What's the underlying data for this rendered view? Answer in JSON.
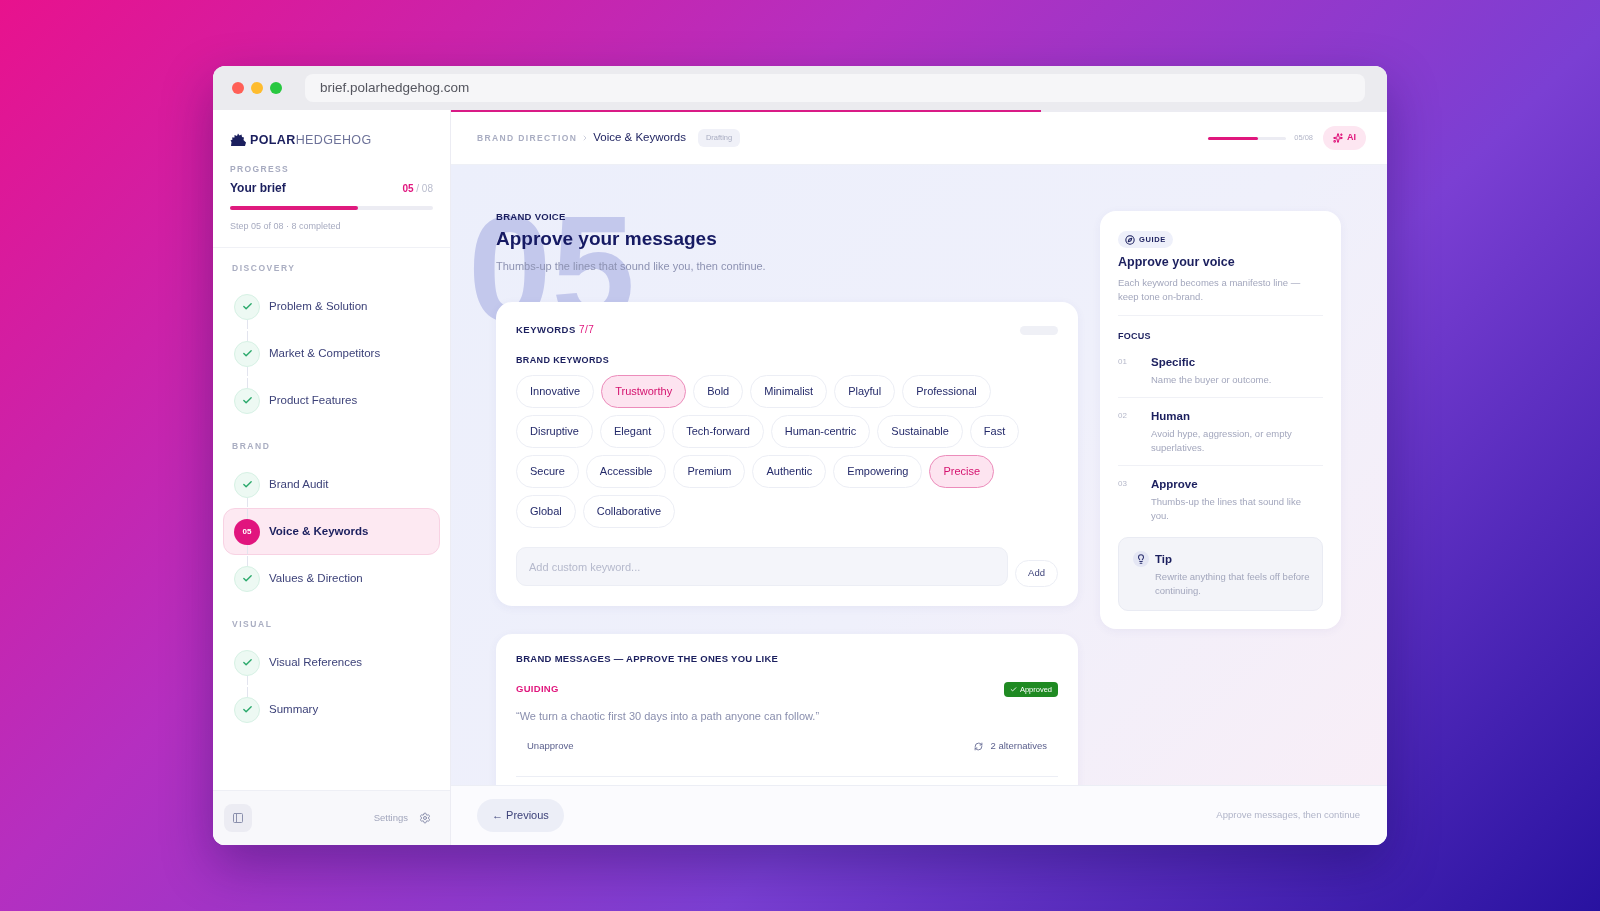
{
  "browser": {
    "url": "brief.polarhedgehog.com"
  },
  "sidebar": {
    "logo": {
      "strong": "POLAR",
      "light": "HEDGEHOG"
    },
    "progress": {
      "label": "PROGRESS",
      "title": "Your brief",
      "current": "05",
      "total": "/ 08",
      "level": 0.63,
      "caption": "Step 05 of 08 · 8 completed"
    },
    "sections": [
      {
        "label": "DISCOVERY",
        "items": [
          {
            "label": "Problem & Solution",
            "kind": "done",
            "selected": false
          },
          {
            "label": "Market & Competitors",
            "kind": "done",
            "selected": false
          },
          {
            "label": "Product Features",
            "kind": "done",
            "selected": false
          }
        ]
      },
      {
        "label": "BRAND",
        "items": [
          {
            "label": "Brand Audit",
            "kind": "done",
            "selected": false
          },
          {
            "label": "Voice & Keywords",
            "kind": "current",
            "step": "05",
            "selected": true
          },
          {
            "label": "Values & Direction",
            "kind": "done",
            "selected": false
          }
        ]
      },
      {
        "label": "VISUAL",
        "items": [
          {
            "label": "Visual References",
            "kind": "done",
            "selected": false
          },
          {
            "label": "Summary",
            "kind": "done",
            "selected": false
          }
        ]
      }
    ],
    "footer": {
      "settings": "Settings"
    }
  },
  "header": {
    "top_progress": {
      "level": 0.63
    },
    "breadcrumb": {
      "parent": "BRAND DIRECTION",
      "current": "Voice & Keywords"
    },
    "status": "Drafting",
    "progress": {
      "level": 0.64,
      "reading": "05/08"
    },
    "ai_button": "AI"
  },
  "intro": {
    "watermark": "05",
    "eyebrow": "BRAND VOICE",
    "title": "Approve your messages",
    "subtitle": "Thumbs-up the lines that sound like you, then continue."
  },
  "keywords_card": {
    "title": "KEYWORDS",
    "count": "7/7",
    "section": "BRAND KEYWORDS",
    "keywords": [
      {
        "label": "Innovative",
        "selected": false
      },
      {
        "label": "Trustworthy",
        "selected": true
      },
      {
        "label": "Bold",
        "selected": false
      },
      {
        "label": "Minimalist",
        "selected": false
      },
      {
        "label": "Playful",
        "selected": false
      },
      {
        "label": "Professional",
        "selected": false
      },
      {
        "label": "Disruptive",
        "selected": false
      },
      {
        "label": "Elegant",
        "selected": false
      },
      {
        "label": "Tech-forward",
        "selected": false
      },
      {
        "label": "Human-centric",
        "selected": false
      },
      {
        "label": "Sustainable",
        "selected": false
      },
      {
        "label": "Fast",
        "selected": false
      },
      {
        "label": "Secure",
        "selected": false
      },
      {
        "label": "Accessible",
        "selected": false
      },
      {
        "label": "Premium",
        "selected": false
      },
      {
        "label": "Authentic",
        "selected": false
      },
      {
        "label": "Empowering",
        "selected": false
      },
      {
        "label": "Precise",
        "selected": true
      },
      {
        "label": "Global",
        "selected": false
      },
      {
        "label": "Collaborative",
        "selected": false
      }
    ],
    "input": {
      "placeholder": "Add custom keyword..."
    },
    "add_button": "Add"
  },
  "messages_card": {
    "title": "BRAND MESSAGES — APPROVE THE ONES YOU LIKE",
    "messages": [
      {
        "category": "GUIDING",
        "approved": true,
        "badge": "Approved",
        "text": "“We turn a chaotic first 30 days into a path anyone can follow.”",
        "action": "Unapprove",
        "alternatives": "2 alternatives"
      }
    ]
  },
  "guide": {
    "tag": "GUIDE",
    "title": "Approve your voice",
    "description": "Each keyword becomes a manifesto line — keep tone on-brand.",
    "focus_label": "FOCUS",
    "focus": [
      {
        "number": "01",
        "title": "Specific",
        "text": "Name the buyer or outcome."
      },
      {
        "number": "02",
        "title": "Human",
        "text": "Avoid hype, aggression, or empty superlatives."
      },
      {
        "number": "03",
        "title": "Approve",
        "text": "Thumbs-up the lines that sound like you."
      }
    ],
    "tip": {
      "title": "Tip",
      "text": "Rewrite anything that feels off before continuing."
    }
  },
  "footer": {
    "previous": "← Previous",
    "hint": "Approve messages, then continue"
  }
}
